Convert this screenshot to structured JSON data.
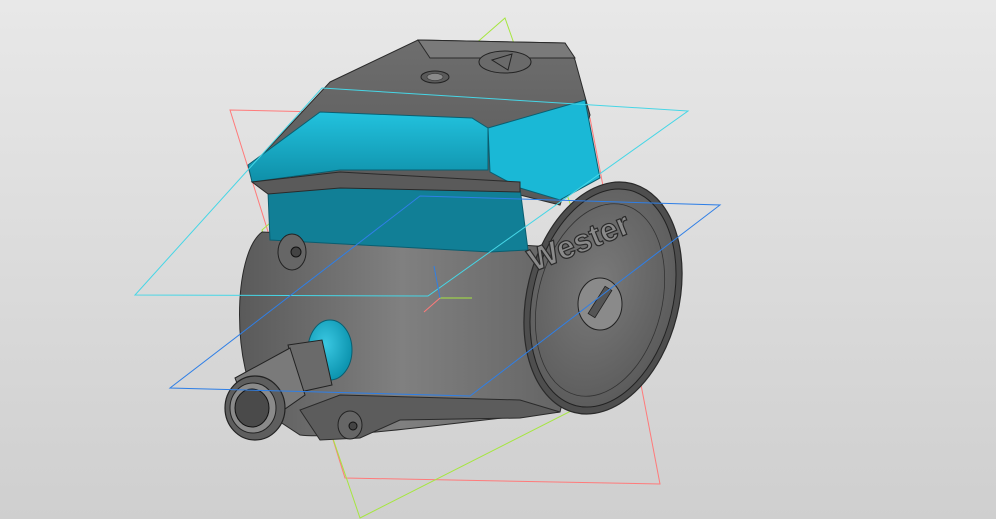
{
  "viewport": {
    "background_top": "#e8e8e8",
    "background_bottom": "#cfcfcf"
  },
  "model": {
    "brand_label": "Wester",
    "body_color": "#6a6a6a",
    "highlight_color": "#1ab8d6"
  },
  "planes": {
    "red_color": "#ff7a7a",
    "green_color": "#a6e640",
    "cyan_color": "#46d6e6",
    "blue_color": "#2f7fe6"
  }
}
